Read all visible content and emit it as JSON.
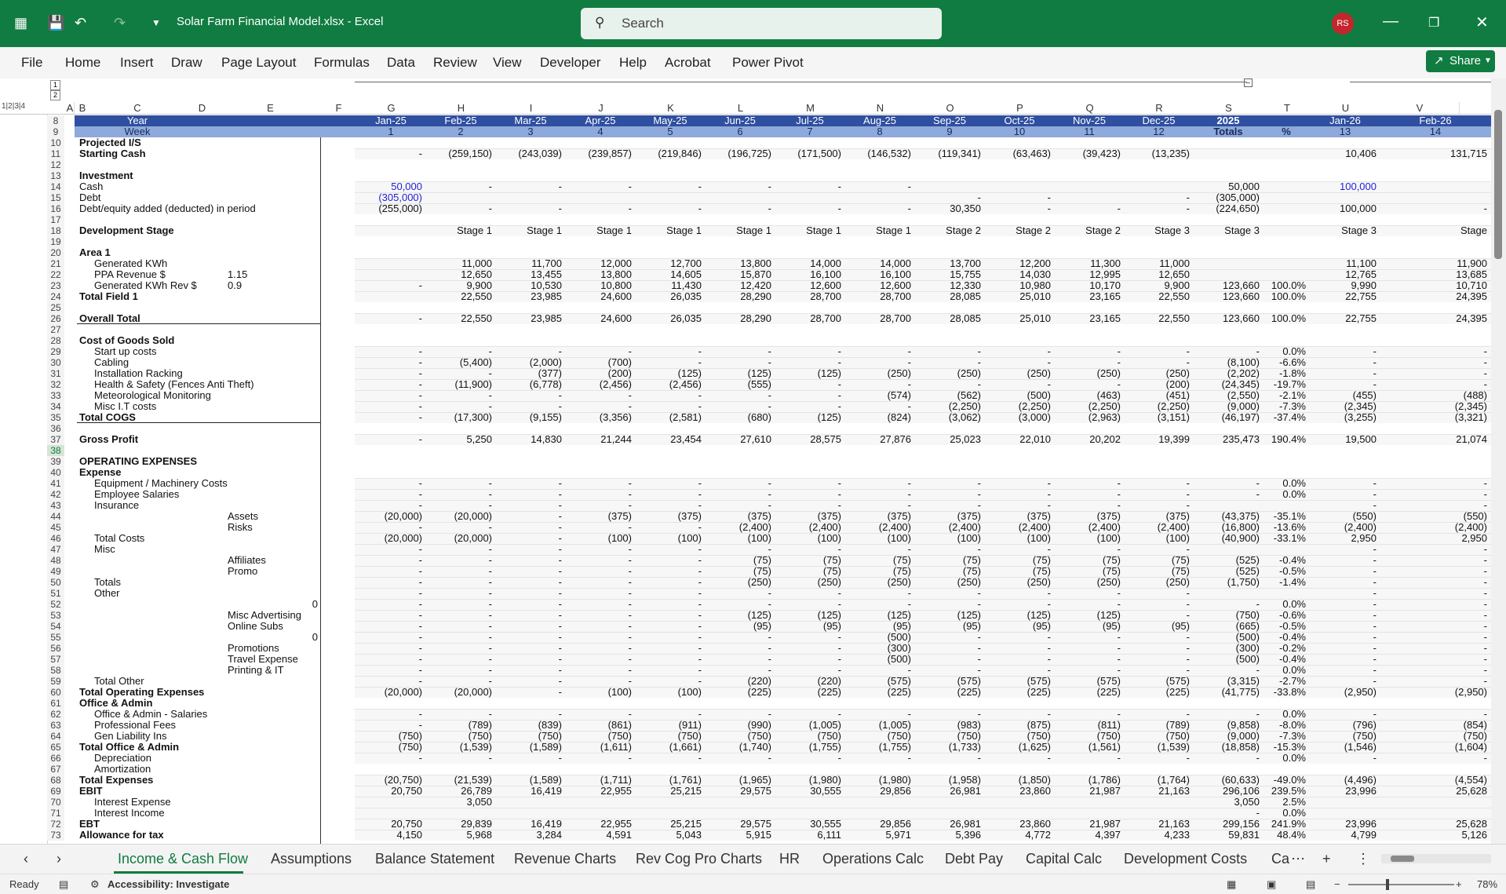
{
  "app": {
    "title": "Solar Farm Financial Model.xlsx  -  Excel",
    "search_placeholder": "Search",
    "user_initials": "RS",
    "share_label": "Share"
  },
  "menu": [
    "File",
    "Home",
    "Insert",
    "Draw",
    "Page Layout",
    "Formulas",
    "Data",
    "Review",
    "View",
    "Developer",
    "Help",
    "Acrobat",
    "Power Pivot"
  ],
  "columns": [
    "A",
    "B",
    "C",
    "D",
    "E",
    "F",
    "G",
    "H",
    "I",
    "J",
    "K",
    "L",
    "M",
    "N",
    "O",
    "P",
    "Q",
    "R",
    "S",
    "T",
    "U",
    "V"
  ],
  "header": {
    "year_label": "Year",
    "week_label": "Week",
    "months": [
      "Jan-25",
      "Feb-25",
      "Mar-25",
      "Apr-25",
      "May-25",
      "Jun-25",
      "Jul-25",
      "Aug-25",
      "Sep-25",
      "Oct-25",
      "Nov-25",
      "Dec-25",
      "2025",
      "",
      "Jan-26",
      "Feb-26"
    ],
    "weeks": [
      "1",
      "2",
      "3",
      "4",
      "5",
      "6",
      "7",
      "8",
      "9",
      "10",
      "11",
      "12",
      "Totals",
      "%",
      "13",
      "14"
    ]
  },
  "rows": [
    {
      "n": "10",
      "label": "Projected I/S",
      "bold": true,
      "v": []
    },
    {
      "n": "11",
      "label": "Starting Cash",
      "bold": true,
      "v": [
        "-",
        "(259,150)",
        "(243,039)",
        "(239,857)",
        "(219,846)",
        "(196,725)",
        "(171,500)",
        "(146,532)",
        "(119,341)",
        "(63,463)",
        "(39,423)",
        "(13,235)",
        "",
        "",
        "10,406",
        "131,715"
      ]
    },
    {
      "n": "12",
      "label": "",
      "v": []
    },
    {
      "n": "13",
      "label": "Investment",
      "bold": true,
      "v": []
    },
    {
      "n": "14",
      "label": "Cash",
      "v": [
        "50,000",
        "-",
        "-",
        "-",
        "-",
        "-",
        "-",
        "-",
        "",
        "",
        "",
        "",
        "50,000",
        "",
        "100,000",
        ""
      ],
      "blue": true
    },
    {
      "n": "15",
      "label": "Debt",
      "v": [
        "(305,000)",
        "",
        "",
        "",
        "",
        "",
        "",
        "",
        "-",
        "-",
        "",
        "-",
        "(305,000)",
        "",
        "",
        ""
      ],
      "blue": true
    },
    {
      "n": "16",
      "label": "Debt/equity added (deducted) in period",
      "v": [
        "(255,000)",
        "-",
        "-",
        "-",
        "-",
        "-",
        "-",
        "-",
        "30,350",
        "-",
        "-",
        "-",
        "(224,650)",
        "",
        "100,000",
        "-"
      ]
    },
    {
      "n": "17",
      "label": "",
      "v": []
    },
    {
      "n": "18",
      "label": "Development Stage",
      "bold": true,
      "v": [
        "",
        "Stage 1",
        "Stage 1",
        "Stage 1",
        "Stage 1",
        "Stage 1",
        "Stage 1",
        "Stage 1",
        "Stage 2",
        "Stage 2",
        "Stage 2",
        "Stage 3",
        "Stage 3",
        "",
        "Stage 3",
        "Stage"
      ]
    },
    {
      "n": "19",
      "label": "",
      "v": []
    },
    {
      "n": "20",
      "label": "Area 1",
      "bold": true,
      "v": []
    },
    {
      "n": "21",
      "label": "Generated KWh",
      "indent": 1,
      "v": [
        "",
        "11,000",
        "11,700",
        "12,000",
        "12,700",
        "13,800",
        "14,000",
        "14,000",
        "13,700",
        "12,200",
        "11,300",
        "11,000",
        "",
        "",
        "11,100",
        "11,900"
      ]
    },
    {
      "n": "22",
      "label": "PPA Revenue $",
      "indent": 1,
      "d": "1.15",
      "v": [
        "",
        "12,650",
        "13,455",
        "13,800",
        "14,605",
        "15,870",
        "16,100",
        "16,100",
        "15,755",
        "14,030",
        "12,995",
        "12,650",
        "",
        "",
        "12,765",
        "13,685"
      ]
    },
    {
      "n": "23",
      "label": "Generated KWh Rev $",
      "indent": 1,
      "d": "0.9",
      "v": [
        "-",
        "9,900",
        "10,530",
        "10,800",
        "11,430",
        "12,420",
        "12,600",
        "12,600",
        "12,330",
        "10,980",
        "10,170",
        "9,900",
        "123,660",
        "100.0%",
        "9,990",
        "10,710"
      ]
    },
    {
      "n": "24",
      "label": "Total Field 1",
      "bold": true,
      "v": [
        "",
        "22,550",
        "23,985",
        "24,600",
        "26,035",
        "28,290",
        "28,700",
        "28,700",
        "28,085",
        "25,010",
        "23,165",
        "22,550",
        "123,660",
        "100.0%",
        "22,755",
        "24,395"
      ]
    },
    {
      "n": "25",
      "label": "",
      "v": []
    },
    {
      "n": "26",
      "label": "Overall Total",
      "bold": true,
      "v": [
        "-",
        "22,550",
        "23,985",
        "24,600",
        "26,035",
        "28,290",
        "28,700",
        "28,700",
        "28,085",
        "25,010",
        "23,165",
        "22,550",
        "123,660",
        "100.0%",
        "22,755",
        "24,395"
      ]
    },
    {
      "n": "27",
      "label": "",
      "v": []
    },
    {
      "n": "28",
      "label": "Cost of Goods Sold",
      "bold": true,
      "v": []
    },
    {
      "n": "29",
      "label": "Start up costs",
      "indent": 1,
      "v": [
        "-",
        "-",
        "-",
        "-",
        "-",
        "-",
        "-",
        "-",
        "-",
        "-",
        "-",
        "-",
        "-",
        "0.0%",
        "-",
        "-"
      ]
    },
    {
      "n": "30",
      "label": "Cabling",
      "indent": 1,
      "v": [
        "-",
        "(5,400)",
        "(2,000)",
        "(700)",
        "-",
        "-",
        "-",
        "-",
        "-",
        "-",
        "-",
        "-",
        "(8,100)",
        "-6.6%",
        "-",
        "-"
      ]
    },
    {
      "n": "31",
      "label": "Installation Racking",
      "indent": 1,
      "v": [
        "-",
        "-",
        "(377)",
        "(200)",
        "(125)",
        "(125)",
        "(125)",
        "(250)",
        "(250)",
        "(250)",
        "(250)",
        "(250)",
        "(2,202)",
        "-1.8%",
        "-",
        "-"
      ]
    },
    {
      "n": "32",
      "label": "Health & Safety (Fences Anti Theft)",
      "indent": 1,
      "v": [
        "-",
        "(11,900)",
        "(6,778)",
        "(2,456)",
        "(2,456)",
        "(555)",
        "-",
        "-",
        "-",
        "-",
        "-",
        "(200)",
        "(24,345)",
        "-19.7%",
        "-",
        "-"
      ]
    },
    {
      "n": "33",
      "label": "Meteorological Monitoring",
      "indent": 1,
      "v": [
        "-",
        "-",
        "-",
        "-",
        "-",
        "-",
        "-",
        "(574)",
        "(562)",
        "(500)",
        "(463)",
        "(451)",
        "(2,550)",
        "-2.1%",
        "(455)",
        "(488)"
      ]
    },
    {
      "n": "34",
      "label": "Misc I.T costs",
      "indent": 1,
      "v": [
        "-",
        "-",
        "-",
        "-",
        "-",
        "-",
        "-",
        "-",
        "(2,250)",
        "(2,250)",
        "(2,250)",
        "(2,250)",
        "(9,000)",
        "-7.3%",
        "(2,345)",
        "(2,345)"
      ]
    },
    {
      "n": "35",
      "label": "Total COGS",
      "bold": true,
      "v": [
        "-",
        "(17,300)",
        "(9,155)",
        "(3,356)",
        "(2,581)",
        "(680)",
        "(125)",
        "(824)",
        "(3,062)",
        "(3,000)",
        "(2,963)",
        "(3,151)",
        "(46,197)",
        "-37.4%",
        "(3,255)",
        "(3,321)"
      ]
    },
    {
      "n": "36",
      "label": "",
      "v": []
    },
    {
      "n": "37",
      "label": "Gross Profit",
      "bold": true,
      "v": [
        "-",
        "5,250",
        "14,830",
        "21,244",
        "23,454",
        "27,610",
        "28,575",
        "27,876",
        "25,023",
        "22,010",
        "20,202",
        "19,399",
        "235,473",
        "190.4%",
        "19,500",
        "21,074"
      ]
    },
    {
      "n": "38",
      "label": "",
      "v": []
    },
    {
      "n": "39",
      "label": "OPERATING EXPENSES",
      "bold": true,
      "v": []
    },
    {
      "n": "40",
      "label": "Expense",
      "bold": true,
      "v": []
    },
    {
      "n": "41",
      "label": "Equipment / Machinery Costs",
      "indent": 1,
      "v": [
        "-",
        "-",
        "-",
        "-",
        "-",
        "-",
        "-",
        "-",
        "-",
        "-",
        "-",
        "-",
        "-",
        "0.0%",
        "-",
        "-"
      ]
    },
    {
      "n": "42",
      "label": "Employee Salaries",
      "indent": 1,
      "v": [
        "-",
        "-",
        "-",
        "-",
        "-",
        "-",
        "-",
        "-",
        "-",
        "-",
        "-",
        "-",
        "-",
        "0.0%",
        "-",
        "-"
      ]
    },
    {
      "n": "43",
      "label": "Insurance",
      "indent": 1,
      "v": [
        "-",
        "-",
        "-",
        "-",
        "-",
        "-",
        "-",
        "-",
        "-",
        "-",
        "-",
        "-",
        "",
        "",
        "-",
        "-"
      ]
    },
    {
      "n": "44",
      "label": "Assets",
      "indent": 3,
      "v": [
        "(20,000)",
        "(20,000)",
        "-",
        "(375)",
        "(375)",
        "(375)",
        "(375)",
        "(375)",
        "(375)",
        "(375)",
        "(375)",
        "(375)",
        "(43,375)",
        "-35.1%",
        "(550)",
        "(550)"
      ]
    },
    {
      "n": "45",
      "label": "Risks",
      "indent": 3,
      "v": [
        "-",
        "-",
        "-",
        "-",
        "-",
        "(2,400)",
        "(2,400)",
        "(2,400)",
        "(2,400)",
        "(2,400)",
        "(2,400)",
        "(2,400)",
        "(16,800)",
        "-13.6%",
        "(2,400)",
        "(2,400)"
      ]
    },
    {
      "n": "46",
      "label": "Total Costs",
      "indent": 1,
      "v": [
        "(20,000)",
        "(20,000)",
        "-",
        "(100)",
        "(100)",
        "(100)",
        "(100)",
        "(100)",
        "(100)",
        "(100)",
        "(100)",
        "(100)",
        "(40,900)",
        "-33.1%",
        "2,950",
        "2,950"
      ]
    },
    {
      "n": "47",
      "label": "Misc",
      "indent": 1,
      "v": [
        "-",
        "-",
        "-",
        "-",
        "-",
        "-",
        "-",
        "-",
        "-",
        "-",
        "-",
        "-",
        "",
        "",
        "-",
        "-"
      ]
    },
    {
      "n": "48",
      "label": "Affiliates",
      "indent": 3,
      "v": [
        "-",
        "-",
        "-",
        "-",
        "-",
        "(75)",
        "(75)",
        "(75)",
        "(75)",
        "(75)",
        "(75)",
        "(75)",
        "(525)",
        "-0.4%",
        "-",
        "-"
      ]
    },
    {
      "n": "49",
      "label": "Promo",
      "indent": 3,
      "v": [
        "-",
        "-",
        "-",
        "-",
        "-",
        "(75)",
        "(75)",
        "(75)",
        "(75)",
        "(75)",
        "(75)",
        "(75)",
        "(525)",
        "-0.5%",
        "-",
        "-"
      ]
    },
    {
      "n": "50",
      "label": "Totals",
      "indent": 1,
      "v": [
        "-",
        "-",
        "-",
        "-",
        "-",
        "(250)",
        "(250)",
        "(250)",
        "(250)",
        "(250)",
        "(250)",
        "(250)",
        "(1,750)",
        "-1.4%",
        "-",
        "-"
      ]
    },
    {
      "n": "51",
      "label": "Other",
      "indent": 1,
      "v": [
        "-",
        "-",
        "-",
        "-",
        "-",
        "-",
        "-",
        "-",
        "-",
        "-",
        "-",
        "-",
        "",
        "",
        "-",
        "-"
      ]
    },
    {
      "n": "52",
      "label": "",
      "e": "0",
      "v": [
        "-",
        "-",
        "-",
        "-",
        "-",
        "-",
        "-",
        "-",
        "-",
        "-",
        "-",
        "-",
        "-",
        "0.0%",
        "-",
        "-"
      ]
    },
    {
      "n": "53",
      "label": "Misc Advertising",
      "indent": 3,
      "v": [
        "-",
        "-",
        "-",
        "-",
        "-",
        "(125)",
        "(125)",
        "(125)",
        "(125)",
        "(125)",
        "(125)",
        "-",
        "(750)",
        "-0.6%",
        "-",
        "-"
      ]
    },
    {
      "n": "54",
      "label": "Online Subs",
      "indent": 3,
      "v": [
        "-",
        "-",
        "-",
        "-",
        "-",
        "(95)",
        "(95)",
        "(95)",
        "(95)",
        "(95)",
        "(95)",
        "(95)",
        "(665)",
        "-0.5%",
        "-",
        "-"
      ]
    },
    {
      "n": "55",
      "label": "",
      "e": "0",
      "v": [
        "-",
        "-",
        "-",
        "-",
        "-",
        "-",
        "-",
        "(500)",
        "-",
        "-",
        "-",
        "-",
        "(500)",
        "-0.4%",
        "-",
        "-"
      ]
    },
    {
      "n": "56",
      "label": "Promotions",
      "indent": 3,
      "v": [
        "-",
        "-",
        "-",
        "-",
        "-",
        "-",
        "-",
        "(300)",
        "-",
        "-",
        "-",
        "-",
        "(300)",
        "-0.2%",
        "-",
        "-"
      ]
    },
    {
      "n": "57",
      "label": "Travel Expense",
      "indent": 3,
      "v": [
        "-",
        "-",
        "-",
        "-",
        "-",
        "-",
        "-",
        "(500)",
        "-",
        "-",
        "-",
        "-",
        "(500)",
        "-0.4%",
        "-",
        "-"
      ]
    },
    {
      "n": "58",
      "label": "Printing & IT",
      "indent": 3,
      "v": [
        "-",
        "-",
        "-",
        "-",
        "-",
        "-",
        "-",
        "-",
        "-",
        "-",
        "-",
        "-",
        "-",
        "0.0%",
        "-",
        "-"
      ]
    },
    {
      "n": "59",
      "label": "Total Other",
      "indent": 1,
      "v": [
        "-",
        "-",
        "-",
        "-",
        "-",
        "(220)",
        "(220)",
        "(575)",
        "(575)",
        "(575)",
        "(575)",
        "(575)",
        "(3,315)",
        "-2.7%",
        "-",
        "-"
      ]
    },
    {
      "n": "60",
      "label": "Total Operating Expenses",
      "bold": true,
      "v": [
        "(20,000)",
        "(20,000)",
        "-",
        "(100)",
        "(100)",
        "(225)",
        "(225)",
        "(225)",
        "(225)",
        "(225)",
        "(225)",
        "(225)",
        "(41,775)",
        "-33.8%",
        "(2,950)",
        "(2,950)"
      ]
    },
    {
      "n": "61",
      "label": "Office & Admin",
      "bold": true,
      "v": []
    },
    {
      "n": "62",
      "label": "Office & Admin - Salaries",
      "indent": 1,
      "v": [
        "-",
        "-",
        "-",
        "-",
        "-",
        "-",
        "-",
        "-",
        "-",
        "-",
        "-",
        "-",
        "-",
        "0.0%",
        "-",
        "-"
      ]
    },
    {
      "n": "63",
      "label": "Professional Fees",
      "indent": 1,
      "v": [
        "-",
        "(789)",
        "(839)",
        "(861)",
        "(911)",
        "(990)",
        "(1,005)",
        "(1,005)",
        "(983)",
        "(875)",
        "(811)",
        "(789)",
        "(9,858)",
        "-8.0%",
        "(796)",
        "(854)"
      ]
    },
    {
      "n": "64",
      "label": "Gen Liability Ins",
      "indent": 1,
      "v": [
        "(750)",
        "(750)",
        "(750)",
        "(750)",
        "(750)",
        "(750)",
        "(750)",
        "(750)",
        "(750)",
        "(750)",
        "(750)",
        "(750)",
        "(9,000)",
        "-7.3%",
        "(750)",
        "(750)"
      ]
    },
    {
      "n": "65",
      "label": "Total Office & Admin",
      "bold": true,
      "v": [
        "(750)",
        "(1,539)",
        "(1,589)",
        "(1,611)",
        "(1,661)",
        "(1,740)",
        "(1,755)",
        "(1,755)",
        "(1,733)",
        "(1,625)",
        "(1,561)",
        "(1,539)",
        "(18,858)",
        "-15.3%",
        "(1,546)",
        "(1,604)"
      ]
    },
    {
      "n": "66",
      "label": "Depreciation",
      "indent": 1,
      "v": [
        "-",
        "-",
        "-",
        "-",
        "-",
        "-",
        "-",
        "-",
        "-",
        "-",
        "-",
        "-",
        "-",
        "0.0%",
        "-",
        "-"
      ]
    },
    {
      "n": "67",
      "label": "Amortization",
      "indent": 1,
      "v": []
    },
    {
      "n": "68",
      "label": "Total Expenses",
      "bold": true,
      "v": [
        "(20,750)",
        "(21,539)",
        "(1,589)",
        "(1,711)",
        "(1,761)",
        "(1,965)",
        "(1,980)",
        "(1,980)",
        "(1,958)",
        "(1,850)",
        "(1,786)",
        "(1,764)",
        "(60,633)",
        "-49.0%",
        "(4,496)",
        "(4,554)"
      ]
    },
    {
      "n": "69",
      "label": "EBIT",
      "bold": true,
      "v": [
        "20,750",
        "26,789",
        "16,419",
        "22,955",
        "25,215",
        "29,575",
        "30,555",
        "29,856",
        "26,981",
        "23,860",
        "21,987",
        "21,163",
        "296,106",
        "239.5%",
        "23,996",
        "25,628"
      ]
    },
    {
      "n": "70",
      "label": "Interest Expense",
      "indent": 1,
      "v": [
        "",
        "3,050",
        "",
        "",
        "",
        "",
        "",
        "",
        "",
        "",
        "",
        "",
        "3,050",
        "2.5%",
        "",
        ""
      ]
    },
    {
      "n": "71",
      "label": "Interest Income",
      "indent": 1,
      "v": [
        "",
        "",
        "",
        "",
        "",
        "",
        "",
        "",
        "",
        "",
        "",
        "",
        "-",
        "0.0%",
        "",
        ""
      ]
    },
    {
      "n": "72",
      "label": "EBT",
      "bold": true,
      "v": [
        "20,750",
        "29,839",
        "16,419",
        "22,955",
        "25,215",
        "29,575",
        "30,555",
        "29,856",
        "26,981",
        "23,860",
        "21,987",
        "21,163",
        "299,156",
        "241.9%",
        "23,996",
        "25,628"
      ]
    },
    {
      "n": "73",
      "label": "Allowance for tax",
      "bold": true,
      "v": [
        "4,150",
        "5,968",
        "3,284",
        "4,591",
        "5,043",
        "5,915",
        "6,111",
        "5,971",
        "5,396",
        "4,772",
        "4,397",
        "4,233",
        "59,831",
        "48.4%",
        "4,799",
        "5,126"
      ]
    }
  ],
  "tabs": [
    "Income & Cash Flow",
    "Assumptions",
    "Balance Statement",
    "Revenue Charts",
    "Rev Cog Pro Charts",
    "HR",
    "Operations Calc",
    "Debt Pay",
    "Capital Calc",
    "Development Costs",
    "Ca"
  ],
  "status": {
    "ready": "Ready",
    "accessibility": "Accessibility: Investigate",
    "zoom": "78%"
  }
}
